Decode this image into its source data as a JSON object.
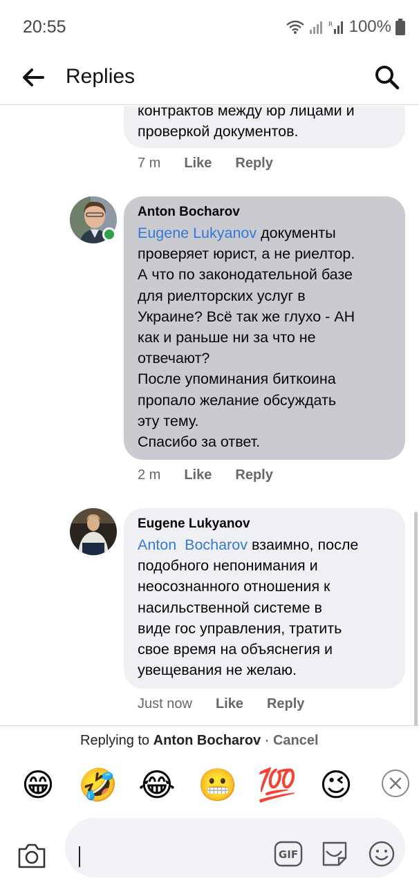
{
  "status": {
    "time": "20:55",
    "battery": "100%"
  },
  "header": {
    "title": "Replies"
  },
  "comments": [
    {
      "author": "",
      "mention": "",
      "body": "контрактов между юр лицами и\nпроверкой документов.",
      "time": "7 m",
      "like": "Like",
      "reply": "Reply"
    },
    {
      "author": "Anton  Bocharov",
      "mention": "Eugene Lukyanov",
      "body": " документы\nпроверяет юрист, а не риелтор.\nА что по законодательной базе\nдля риелторских услуг в\nУкраине? Всё так же глухо - АН\nкак и раньше ни за что не\nотвечают?\nПосле упоминания биткоина\nпропало желание обсуждать\nэту тему.\nСпасибо за ответ.",
      "time": "2 m",
      "like": "Like",
      "reply": "Reply"
    },
    {
      "author": "Eugene Lukyanov",
      "mention": "Anton  Bocharov",
      "body": " взаимно, после\nподобного непонимания и\nнеосознанного отношения к\nнасильственной системе в\nвиде гос управления, тратить\nсвое время на объяснегия и\nувещевания не желаю.",
      "time": "Just now",
      "like": "Like",
      "reply": "Reply"
    }
  ],
  "composer": {
    "replying_prefix": "Replying to ",
    "replying_name": "Anton  Bocharov",
    "separator": " · ",
    "cancel": "Cancel",
    "input_value": "",
    "gif_label": "GIF"
  },
  "quick_emojis": [
    "😁",
    "🤣",
    "😂",
    "😬",
    "💯",
    "😉"
  ]
}
